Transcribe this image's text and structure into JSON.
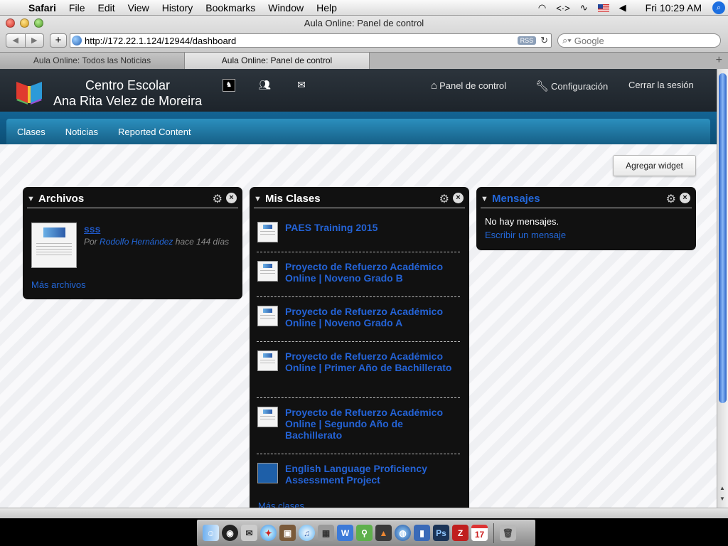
{
  "menubar": {
    "app": "Safari",
    "items": [
      "File",
      "Edit",
      "View",
      "History",
      "Bookmarks",
      "Window",
      "Help"
    ],
    "clock": "Fri 10:29 AM",
    "icons": [
      "wifi-icon",
      "sync-icon",
      "sound-wave-icon",
      "us-flag-icon",
      "volume-icon",
      "spotlight-icon"
    ]
  },
  "browser": {
    "window_title": "Aula Online: Panel de control",
    "url": "http://172.22.1.124/12944/dashboard",
    "rss": "RSS",
    "search_placeholder": "Google",
    "tabs": [
      {
        "label": "Aula Online: Todos las Noticias",
        "active": false
      },
      {
        "label": "Aula Online: Panel de control",
        "active": true
      }
    ]
  },
  "site": {
    "school_line1": "Centro Escolar",
    "school_line2": "Ana Rita Velez de Moreira",
    "nav_right": [
      {
        "label": "Panel de control",
        "icon": "home-icon"
      },
      {
        "label": "Configuración",
        "icon": "wrench-icon"
      },
      {
        "label": "Cerrar la sesión",
        "icon": ""
      }
    ],
    "subnav": [
      "Clases",
      "Noticias",
      "Reported Content"
    ],
    "add_widget": "Agregar widget"
  },
  "archivos": {
    "title": "Archivos",
    "file_name": "sss",
    "by": "Por",
    "author": "Rodolfo Hernández",
    "ago": "hace 144 días",
    "more": "Más archivos"
  },
  "clases": {
    "title": "Mis Clases",
    "items": [
      "PAES Training 2015",
      "Proyecto de Refuerzo Académico Online | Noveno Grado B",
      "Proyecto de Refuerzo Académico Online | Noveno Grado A",
      "Proyecto de Refuerzo Académico Online | Primer Año de Bachillerato",
      "Proyecto de Refuerzo Académico Online | Segundo Año de Bachillerato",
      "English Language Proficiency Assessment Project"
    ],
    "more": "Más clases"
  },
  "mensajes": {
    "title": "Mensajes",
    "empty": "No hay mensajes.",
    "write": "Escribir un mensaje"
  },
  "colors": {
    "header": "#1d242b",
    "subnav": "#1a7aa8",
    "link": "#2367d8",
    "widget_bg": "#111111"
  }
}
